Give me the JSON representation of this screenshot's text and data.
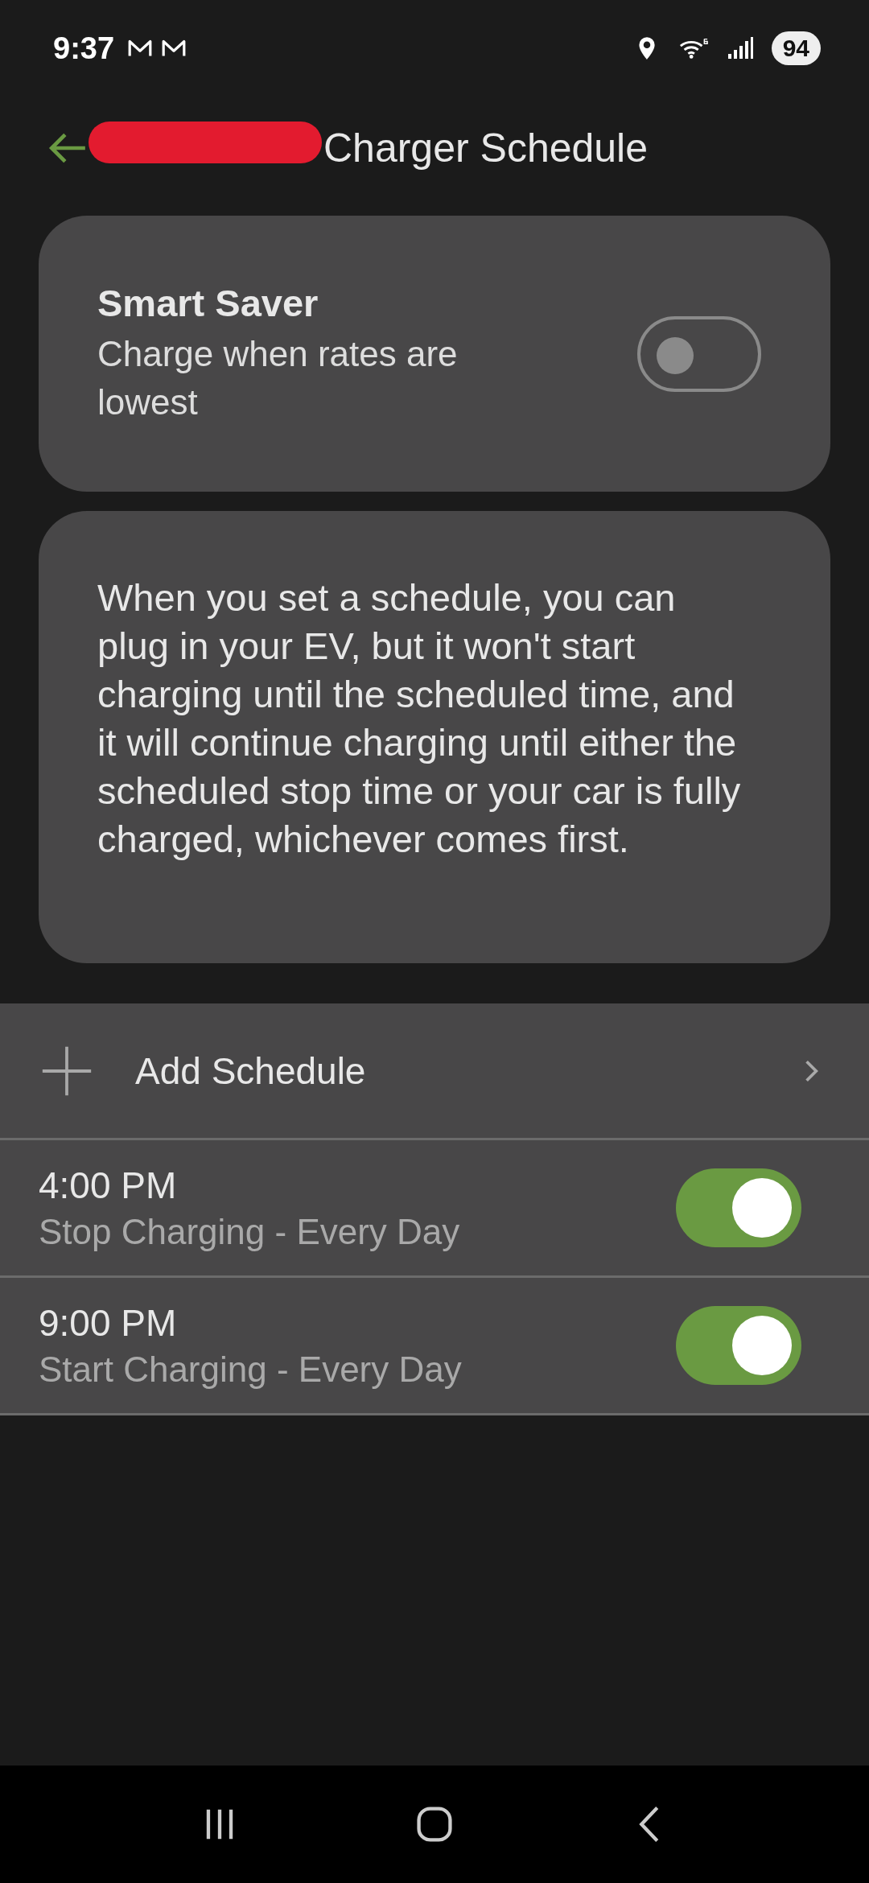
{
  "status_bar": {
    "time": "9:37",
    "battery": "94"
  },
  "header": {
    "title": "Charger Schedule",
    "redacted": true
  },
  "smart_saver": {
    "title": "Smart Saver",
    "subtitle": "Charge when rates are lowest",
    "on": false
  },
  "info": {
    "text": "When you set a schedule, you can plug in your EV, but it won't start charging until the scheduled time, and it will continue charging until either the scheduled stop time or your car is fully charged, whichever comes first."
  },
  "add_schedule": {
    "label": "Add Schedule"
  },
  "schedules": [
    {
      "time": "4:00 PM",
      "description": "Stop Charging - Every Day",
      "on": true
    },
    {
      "time": "9:00 PM",
      "description": "Start Charging - Every Day",
      "on": true
    }
  ]
}
